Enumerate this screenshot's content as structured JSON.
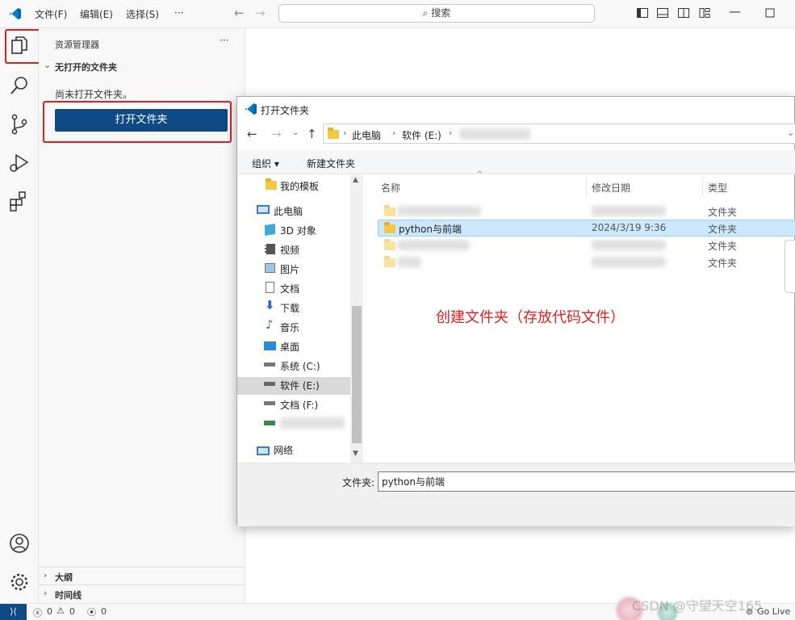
{
  "menu": {
    "file": "文件(F)",
    "edit": "编辑(E)",
    "select": "选择(S)",
    "more": "···"
  },
  "search": {
    "label": "搜索"
  },
  "sidebar": {
    "title": "资源管理器",
    "more": "···",
    "section": "无打开的文件夹",
    "empty_text": "尚未打开文件夹。",
    "open_button": "打开文件夹",
    "outline": "大纲",
    "timeline": "时间线"
  },
  "statusbar": {
    "errors": "0",
    "warnings": "0",
    "ports": "0",
    "golive": "Go Live"
  },
  "dialog": {
    "title": "打开文件夹",
    "breadcrumb": [
      "此电脑",
      "软件 (E:)"
    ],
    "toolbar": {
      "organize": "组织 ▾",
      "new_folder": "新建文件夹"
    },
    "nav_items": [
      "我的模板",
      "此电脑",
      "3D 对象",
      "视频",
      "图片",
      "文档",
      "下载",
      "音乐",
      "桌面",
      "系统 (C:)",
      "软件 (E:)",
      "文档 (F:)",
      "网络"
    ],
    "columns": {
      "name": "名称",
      "date": "修改日期",
      "type": "类型"
    },
    "rows": [
      {
        "name": "",
        "date": "",
        "type": "文件夹"
      },
      {
        "name": "python与前端",
        "date": "2024/3/19 9:36",
        "type": "文件夹"
      },
      {
        "name": "",
        "date": "",
        "type": "文件夹"
      },
      {
        "name": "",
        "date": "",
        "type": "文件夹"
      }
    ],
    "annotation": "创建文件夹（存放代码文件）",
    "folder_label": "文件夹:",
    "folder_value": "python与前端"
  },
  "watermark": "CSDN @守望天空165",
  "colors": {
    "accent": "#0f4a85",
    "highlight": "#cce8ff",
    "annotation": "#e02020"
  }
}
